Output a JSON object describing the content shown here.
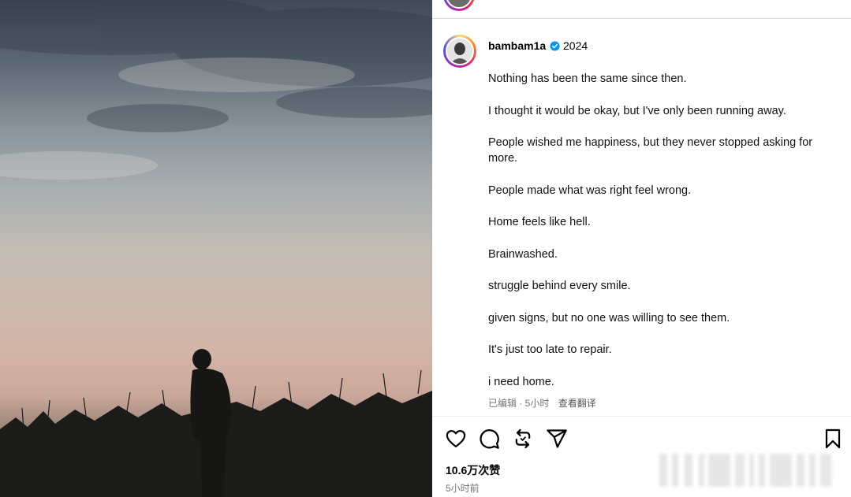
{
  "post": {
    "username": "bambam1a",
    "year": "2024",
    "caption_lines": [
      "Nothing has been the same since then.",
      "I thought it would be okay, but I've only been running away.",
      "People wished me happiness, but they never stopped asking for more.",
      "People made what was right feel wrong.",
      "Home feels like hell.",
      "Brainwashed.",
      "struggle behind every smile.",
      "given signs, but no one was willing to see them.",
      "It's just too late to repair.",
      "i need home."
    ],
    "edited_label": "已编辑 · 5小时",
    "translate_label": "查看翻译",
    "likes": "10.6万次赞",
    "time_ago": "5小时前"
  },
  "icons": {
    "verified": "verified-badge-icon",
    "like": "heart-icon",
    "comment": "comment-icon",
    "repost": "repost-icon",
    "share": "send-icon",
    "save": "bookmark-icon"
  },
  "colors": {
    "verified_blue": "#0095f6",
    "meta_gray": "#737373",
    "divider": "#dbdbdb"
  }
}
